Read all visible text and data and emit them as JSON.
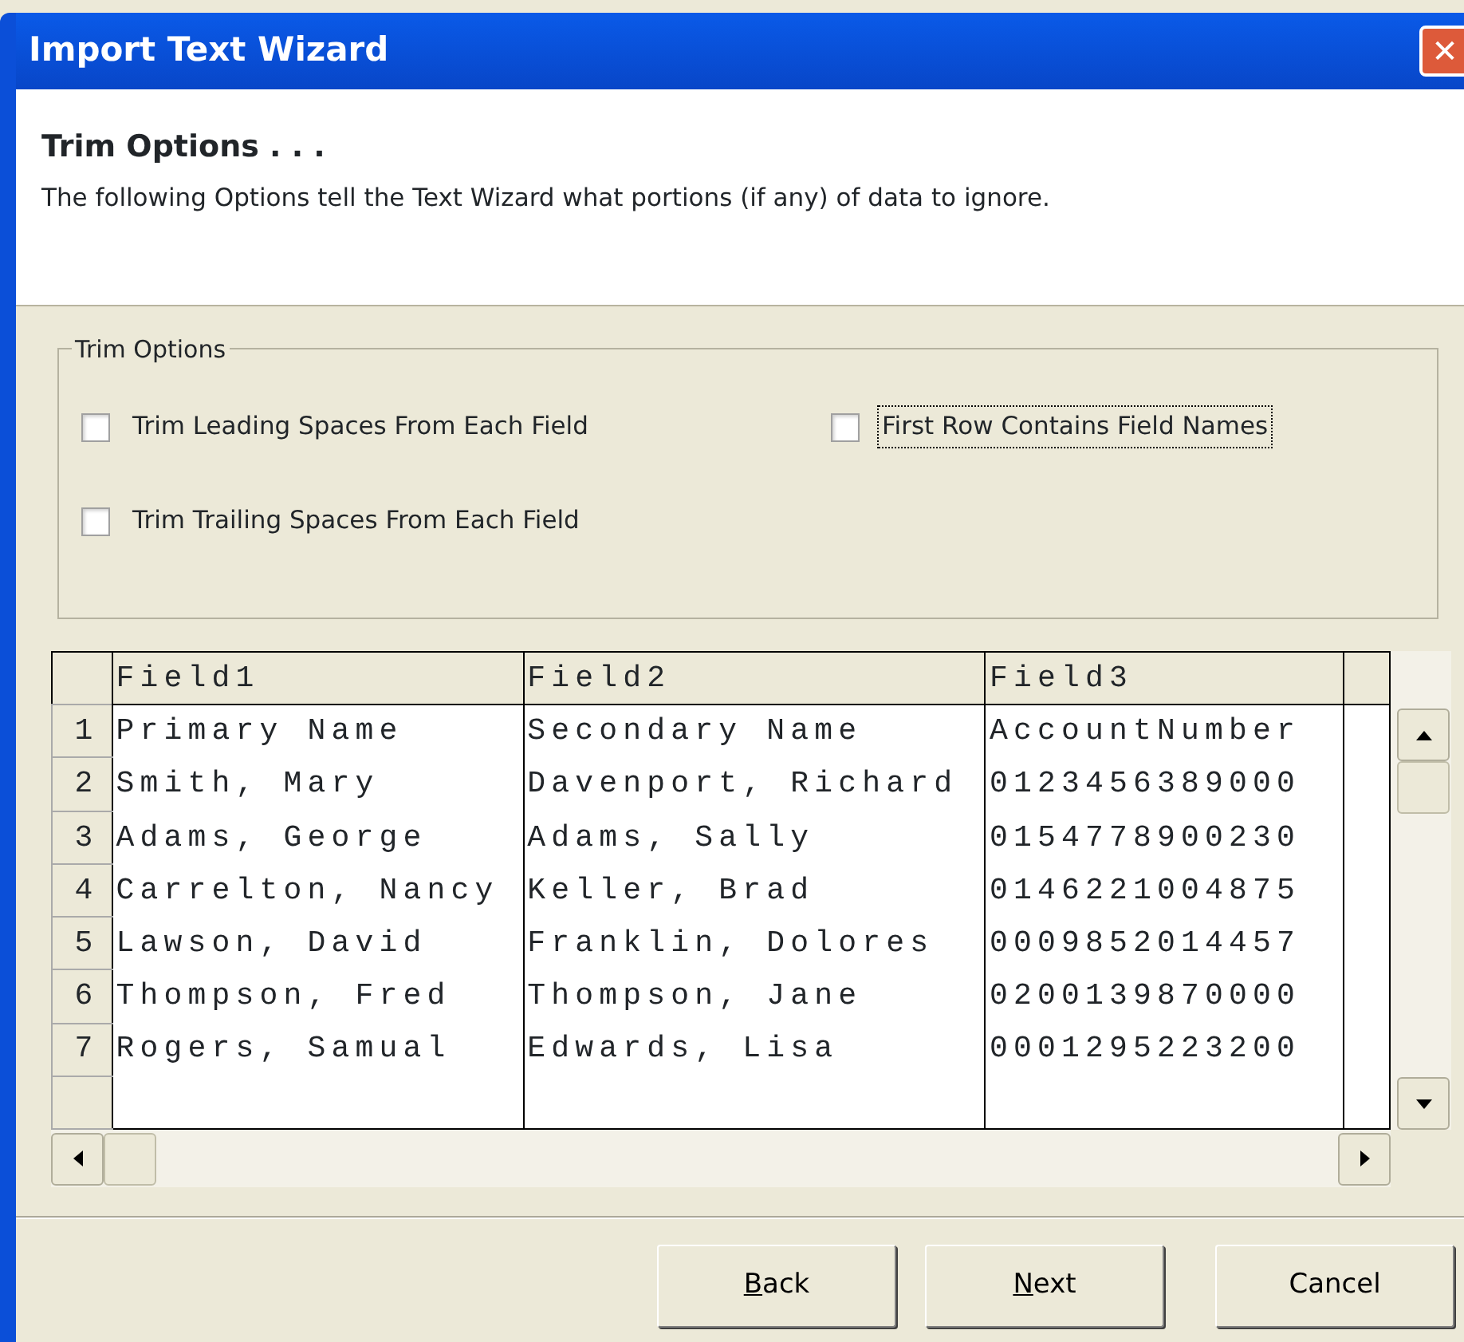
{
  "window": {
    "title": "Import Text Wizard",
    "close_glyph": "✕"
  },
  "header": {
    "title": "Trim Options . . .",
    "description": "The following Options tell the Text Wizard what portions (if any) of data to ignore."
  },
  "group": {
    "legend": "Trim Options",
    "options": [
      {
        "label": "Trim Leading Spaces From Each Field",
        "checked": false,
        "focused": false
      },
      {
        "label": "First Row Contains Field Names",
        "checked": false,
        "focused": true
      },
      {
        "label": "Trim Trailing Spaces From Each Field",
        "checked": false,
        "focused": false
      }
    ]
  },
  "grid": {
    "columns": [
      "Field1",
      "Field2",
      "Field3"
    ],
    "rows": [
      {
        "number": "1",
        "cells": [
          "Primary Name",
          "Secondary Name",
          "AccountNumber"
        ]
      },
      {
        "number": "2",
        "cells": [
          "Smith, Mary",
          "Davenport, Richard",
          "0123456389000"
        ]
      },
      {
        "number": "3",
        "cells": [
          "Adams, George",
          "Adams, Sally",
          "0154778900230"
        ]
      },
      {
        "number": "4",
        "cells": [
          "Carrelton, Nancy",
          "Keller, Brad",
          "0146221004875"
        ]
      },
      {
        "number": "5",
        "cells": [
          "Lawson, David",
          "Franklin, Dolores",
          "0009852014457"
        ]
      },
      {
        "number": "6",
        "cells": [
          "Thompson, Fred",
          "Thompson, Jane",
          "0200139870000"
        ]
      },
      {
        "number": "7",
        "cells": [
          "Rogers, Samual",
          "Edwards, Lisa",
          "0001295223200"
        ]
      }
    ]
  },
  "buttons": [
    {
      "label": "Back",
      "first_letter_underlined": true
    },
    {
      "label": "Next",
      "first_letter_underlined": true
    },
    {
      "label": "Cancel"
    }
  ]
}
